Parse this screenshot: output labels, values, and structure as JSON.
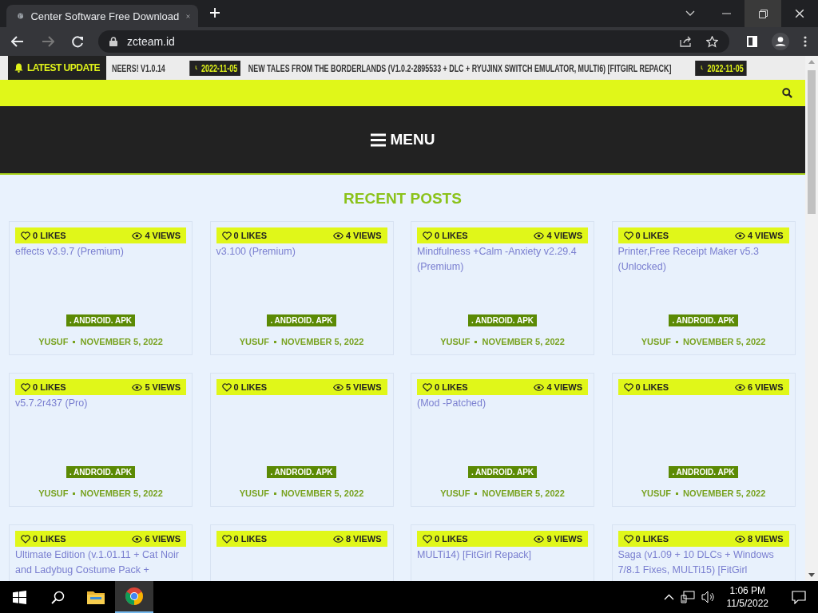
{
  "browser": {
    "tab_title": "Center Software Free Download",
    "url": "zcteam.id"
  },
  "ticker": {
    "label": "LATEST UPDATE",
    "items": [
      {
        "kind": "title",
        "text": "NEERS! V1.0.14"
      },
      {
        "kind": "date",
        "text": "2022-11-05"
      },
      {
        "kind": "title",
        "text": "NEW TALES FROM THE BORDERLANDS (V1.0.2-2895533 + DLC + RYUJINX SWITCH EMULATOR, MULTI6) [FITGIRL REPACK]"
      },
      {
        "kind": "date",
        "text": "2022-11-05"
      }
    ]
  },
  "menu": {
    "label": "MENU"
  },
  "section_title": "RECENT POSTS",
  "posts": [
    {
      "likes": "0 LIKES",
      "views": "4 VIEWS",
      "title": "effects v3.9.7 (Premium)",
      "category": ". ANDROID. APK",
      "author": "YUSUF",
      "date": "NOVEMBER 5, 2022"
    },
    {
      "likes": "0 LIKES",
      "views": "4 VIEWS",
      "title": "v3.100 (Premium)",
      "category": ". ANDROID. APK",
      "author": "YUSUF",
      "date": "NOVEMBER 5, 2022"
    },
    {
      "likes": "0 LIKES",
      "views": "4 VIEWS",
      "title": "Mindfulness +Calm -Anxiety v2.29.4 (Premium)",
      "category": ". ANDROID. APK",
      "author": "YUSUF",
      "date": "NOVEMBER 5, 2022"
    },
    {
      "likes": "0 LIKES",
      "views": "4 VIEWS",
      "title": "Printer,Free Receipt Maker v5.3 (Unlocked)",
      "category": ". ANDROID. APK",
      "author": "YUSUF",
      "date": "NOVEMBER 5, 2022"
    },
    {
      "likes": "0 LIKES",
      "views": "5 VIEWS",
      "title": "v5.7.2r437 (Pro)",
      "category": ". ANDROID. APK",
      "author": "YUSUF",
      "date": "NOVEMBER 5, 2022"
    },
    {
      "likes": "0 LIKES",
      "views": "5 VIEWS",
      "category": ". ANDROID. APK",
      "author": "YUSUF",
      "date": "NOVEMBER 5, 2022"
    },
    {
      "likes": "0 LIKES",
      "views": "4 VIEWS",
      "title": "(Mod -Patched)",
      "category": ". ANDROID. APK",
      "author": "YUSUF",
      "date": "NOVEMBER 5, 2022"
    },
    {
      "likes": "0 LIKES",
      "views": "6 VIEWS",
      "category": ". ANDROID. APK",
      "author": "YUSUF",
      "date": "NOVEMBER 5, 2022"
    },
    {
      "likes": "0 LIKES",
      "views": "6 VIEWS",
      "title": "Ultimate Edition (v.1.01.11 + Cat Noir and Ladybug Costume Pack +"
    },
    {
      "likes": "0 LIKES",
      "views": "8 VIEWS"
    },
    {
      "likes": "0 LIKES",
      "views": "9 VIEWS",
      "title": "MULTi14) [FitGirl Repack]"
    },
    {
      "likes": "0 LIKES",
      "views": "8 VIEWS",
      "title": "Saga (v1.09 + 10 DLCs + Windows 7/8.1 Fixes, MULTi15) [FitGirl"
    }
  ],
  "taskbar": {
    "time": "1:06 PM",
    "date": "11/5/2022"
  }
}
